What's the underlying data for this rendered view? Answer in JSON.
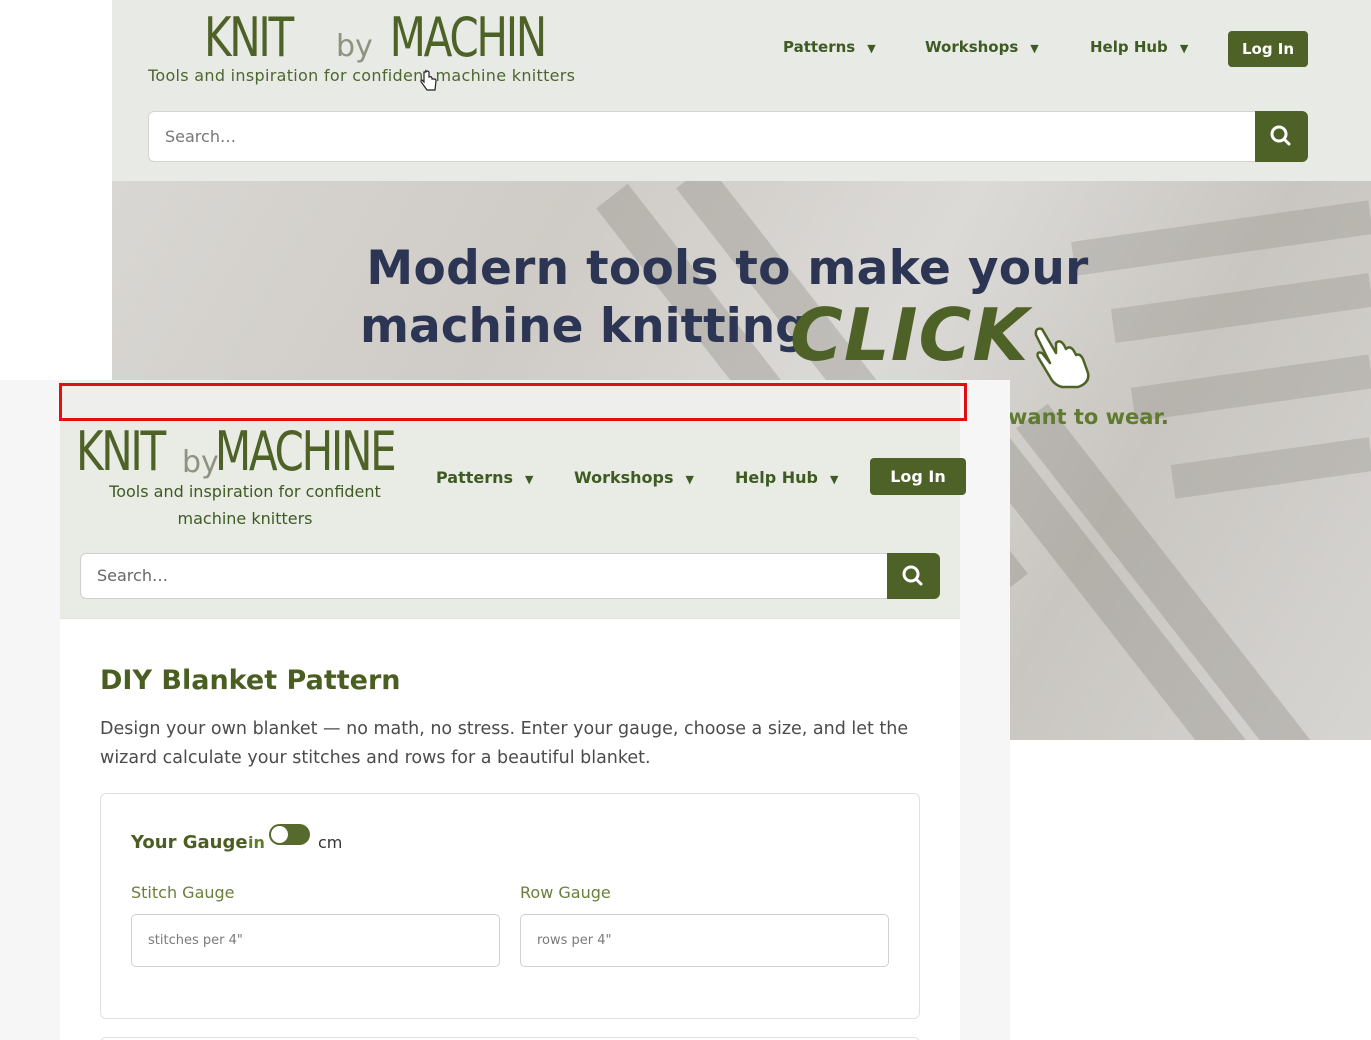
{
  "background_page": {
    "logo_text": "KNIT by MACHINE",
    "tagline": "Tools and inspiration for confident machine knitters",
    "nav": [
      {
        "label": "Patterns"
      },
      {
        "label": "Workshops"
      },
      {
        "label": "Help Hub"
      }
    ],
    "login_label": "Log In",
    "search_placeholder": "Search…",
    "hero": {
      "line1": "Modern tools to make your",
      "line2": "machine knitting",
      "highlight": "CLICK",
      "subtext_visible": "want to wear."
    }
  },
  "foreground_window": {
    "logo_text": "KNIT by MACHINE",
    "tagline": "Tools and inspiration for confident machine knitters",
    "nav": [
      {
        "label": "Patterns"
      },
      {
        "label": "Workshops"
      },
      {
        "label": "Help Hub"
      }
    ],
    "login_label": "Log In",
    "search_placeholder": "Search…",
    "page_title": "DIY Blanket Pattern",
    "page_description": "Design your own blanket — no math, no stress. Enter your gauge, choose a size, and let the wizard calculate your stitches and rows for a beautiful blanket.",
    "gauge": {
      "title": "Your Gauge",
      "unit_left": "in",
      "unit_right": "cm",
      "stitch_label": "Stitch Gauge",
      "stitch_placeholder": "stitches per 4\"",
      "row_label": "Row Gauge",
      "row_placeholder": "rows per 4\""
    }
  },
  "colors": {
    "brand_green": "#4e6227",
    "header_bg": "#e9ebe5",
    "hero_text": "#2c3553",
    "highlight": "#e01010"
  }
}
